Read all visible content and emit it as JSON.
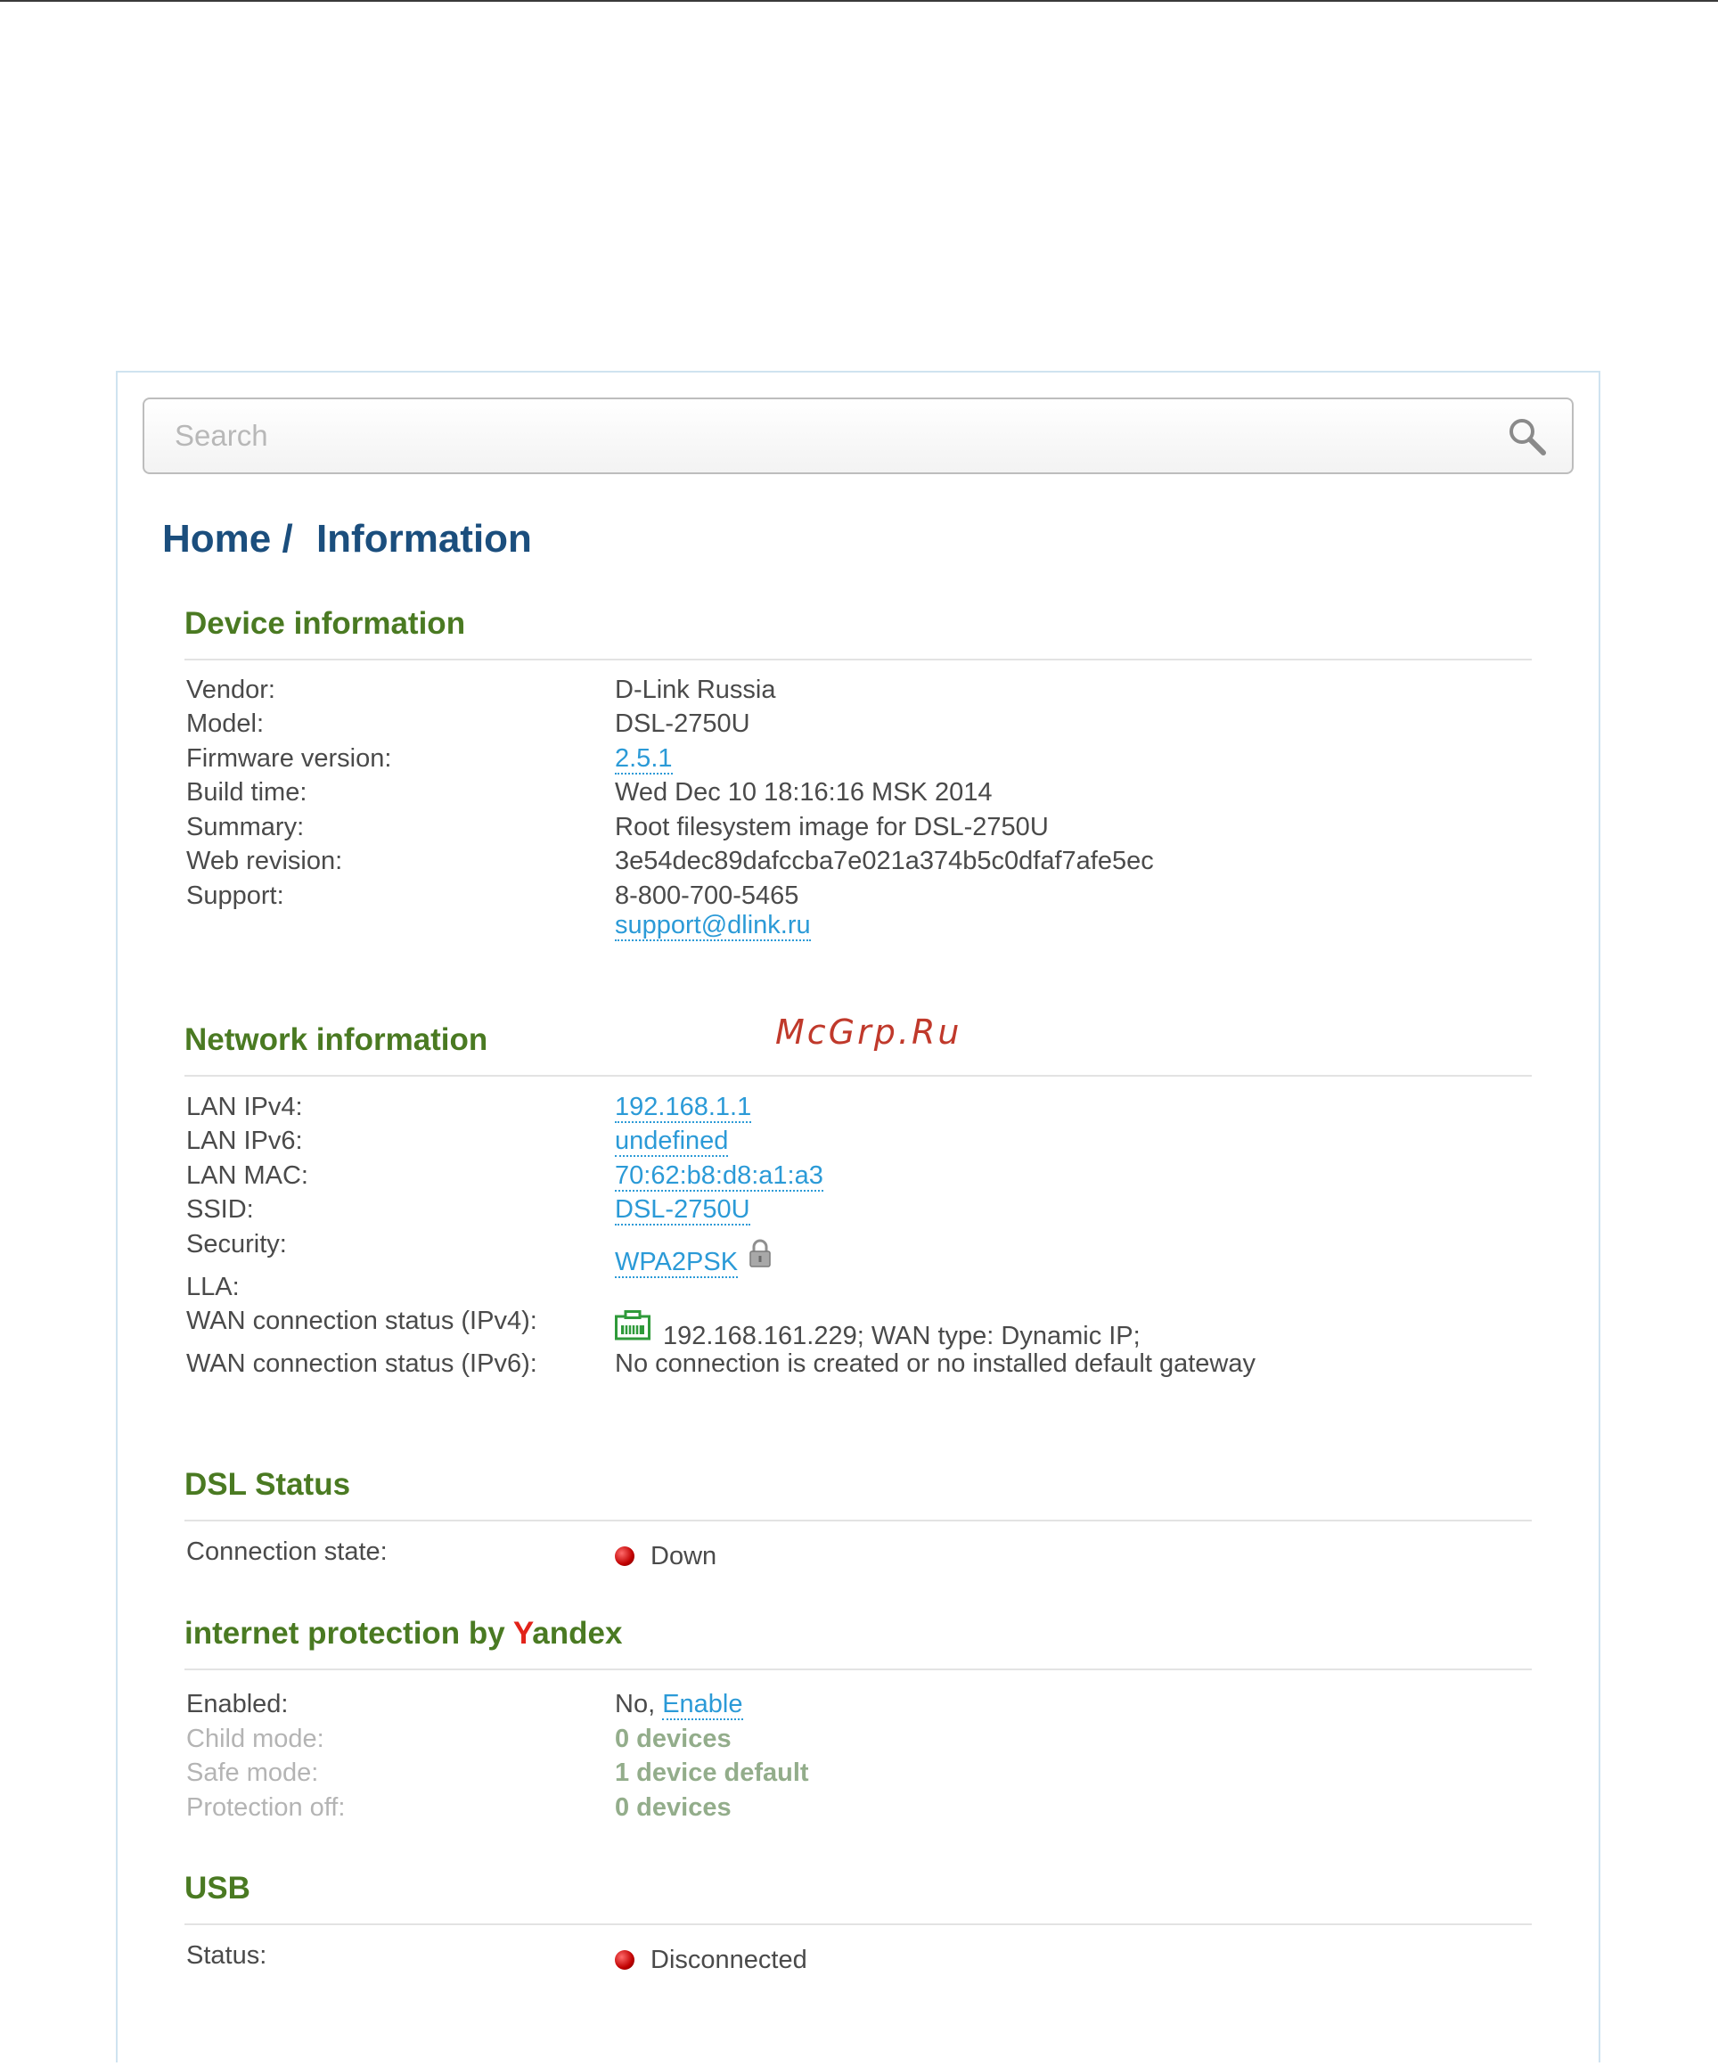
{
  "search": {
    "placeholder": "Search"
  },
  "breadcrumb": {
    "home": "Home /",
    "current": "Information"
  },
  "watermark": "McGrp.Ru",
  "device": {
    "title": "Device information",
    "vendor_label": "Vendor:",
    "vendor": "D-Link Russia",
    "model_label": "Model:",
    "model": "DSL-2750U",
    "firmware_label": "Firmware version:",
    "firmware": "2.5.1",
    "build_label": "Build time:",
    "build": "Wed Dec 10 18:16:16 MSK 2014",
    "summary_label": "Summary:",
    "summary": "Root filesystem image for DSL-2750U",
    "webrev_label": "Web revision:",
    "webrev": "3e54dec89dafccba7e021a374b5c0dfaf7afe5ec",
    "support_label": "Support:",
    "support_phone": "8-800-700-5465",
    "support_email": "support@dlink.ru"
  },
  "network": {
    "title": "Network information",
    "lan_ipv4_label": "LAN IPv4:",
    "lan_ipv4": "192.168.1.1",
    "lan_ipv6_label": "LAN IPv6:",
    "lan_ipv6": "undefined",
    "lan_mac_label": "LAN MAC:",
    "lan_mac": "70:62:b8:d8:a1:a3",
    "ssid_label": "SSID:",
    "ssid": "DSL-2750U",
    "security_label": "Security:",
    "security": "WPA2PSK",
    "lla_label": "LLA:",
    "wan4_label": "WAN connection status (IPv4):",
    "wan4": "192.168.161.229; WAN type: Dynamic IP;",
    "wan6_label": "WAN connection status (IPv6):",
    "wan6": "No connection is created or no installed default gateway"
  },
  "dsl": {
    "title": "DSL Status",
    "state_label": "Connection state:",
    "state": "Down",
    "status_color": "#c00000"
  },
  "yandex": {
    "title_prefix": "internet protection by ",
    "title_y": "Y",
    "title_rest": "andex",
    "enabled_label": "Enabled:",
    "enabled_value": "No,",
    "enable_link": "Enable",
    "child_label": "Child mode:",
    "child": "0 devices",
    "safe_label": "Safe mode:",
    "safe": "1 device default",
    "off_label": "Protection off:",
    "off": "0 devices"
  },
  "usb": {
    "title": "USB",
    "status_label": "Status:",
    "status": "Disconnected"
  },
  "colors": {
    "section_title": "#4a7a22",
    "breadcrumb": "#1b4e7d",
    "link": "#2b9ad7",
    "yandex_red": "#e2231a"
  }
}
